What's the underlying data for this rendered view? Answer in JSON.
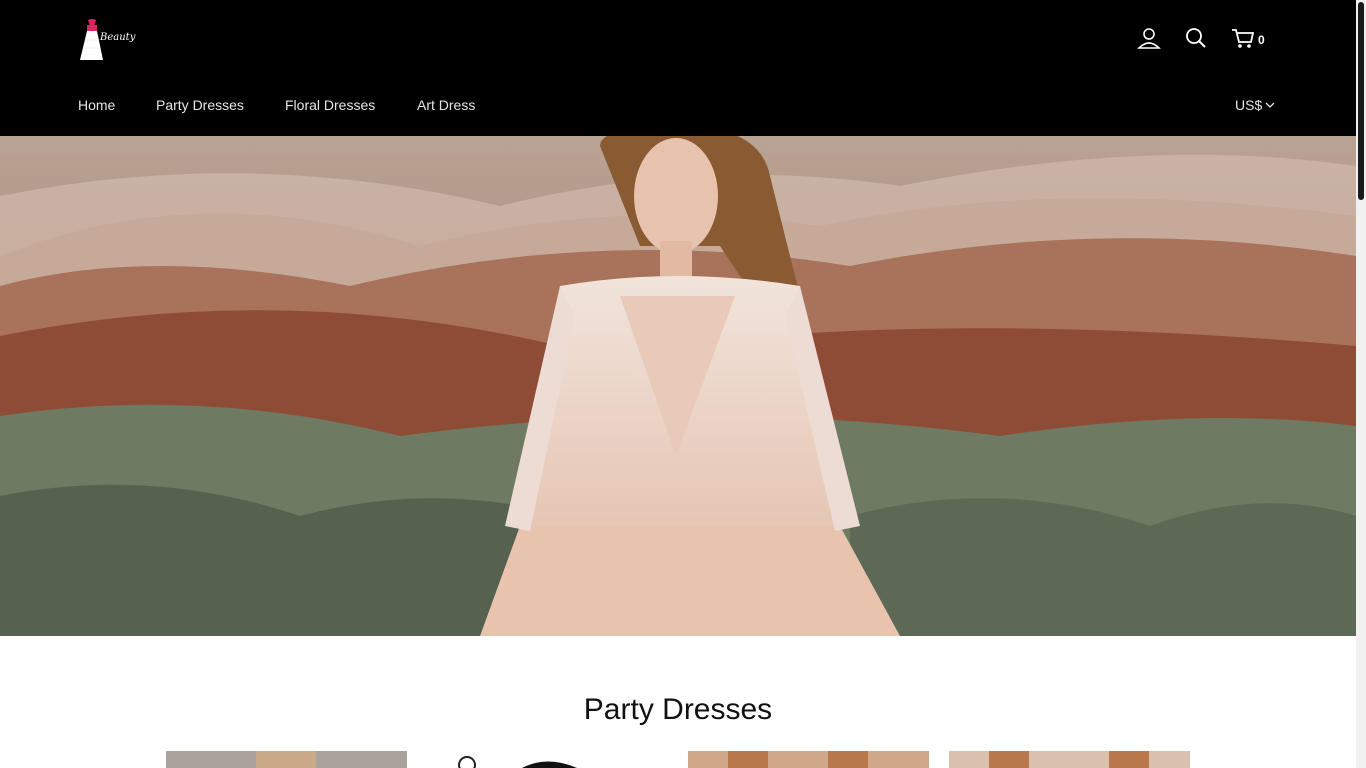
{
  "header": {
    "logo_text": "Beauty",
    "cart_count": "0",
    "icons": [
      "account-icon",
      "search-icon",
      "cart-icon"
    ]
  },
  "nav": {
    "items": [
      {
        "label": "Home"
      },
      {
        "label": "Party Dresses"
      },
      {
        "label": "Floral Dresses"
      },
      {
        "label": "Art Dress"
      }
    ],
    "currency": "US$"
  },
  "sections": {
    "party_title": "Party Dresses"
  },
  "colors": {
    "header_bg": "#000000",
    "logo_accent": "#e0245e"
  }
}
